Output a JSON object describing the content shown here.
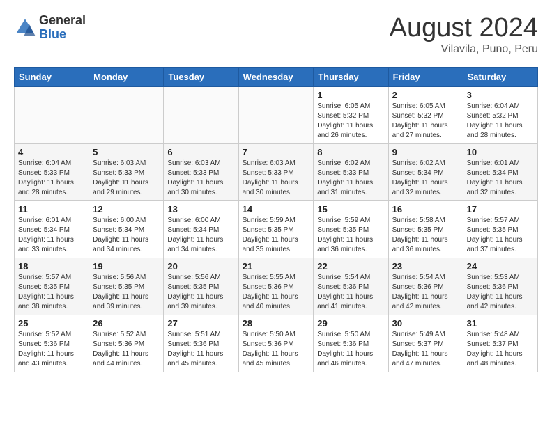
{
  "header": {
    "logo_general": "General",
    "logo_blue": "Blue",
    "title": "August 2024",
    "subtitle": "Vilavila, Puno, Peru"
  },
  "days_of_week": [
    "Sunday",
    "Monday",
    "Tuesday",
    "Wednesday",
    "Thursday",
    "Friday",
    "Saturday"
  ],
  "weeks": [
    [
      {
        "day": "",
        "info": ""
      },
      {
        "day": "",
        "info": ""
      },
      {
        "day": "",
        "info": ""
      },
      {
        "day": "",
        "info": ""
      },
      {
        "day": "1",
        "info": "Sunrise: 6:05 AM\nSunset: 5:32 PM\nDaylight: 11 hours and 26 minutes."
      },
      {
        "day": "2",
        "info": "Sunrise: 6:05 AM\nSunset: 5:32 PM\nDaylight: 11 hours and 27 minutes."
      },
      {
        "day": "3",
        "info": "Sunrise: 6:04 AM\nSunset: 5:32 PM\nDaylight: 11 hours and 28 minutes."
      }
    ],
    [
      {
        "day": "4",
        "info": "Sunrise: 6:04 AM\nSunset: 5:33 PM\nDaylight: 11 hours and 28 minutes."
      },
      {
        "day": "5",
        "info": "Sunrise: 6:03 AM\nSunset: 5:33 PM\nDaylight: 11 hours and 29 minutes."
      },
      {
        "day": "6",
        "info": "Sunrise: 6:03 AM\nSunset: 5:33 PM\nDaylight: 11 hours and 30 minutes."
      },
      {
        "day": "7",
        "info": "Sunrise: 6:03 AM\nSunset: 5:33 PM\nDaylight: 11 hours and 30 minutes."
      },
      {
        "day": "8",
        "info": "Sunrise: 6:02 AM\nSunset: 5:33 PM\nDaylight: 11 hours and 31 minutes."
      },
      {
        "day": "9",
        "info": "Sunrise: 6:02 AM\nSunset: 5:34 PM\nDaylight: 11 hours and 32 minutes."
      },
      {
        "day": "10",
        "info": "Sunrise: 6:01 AM\nSunset: 5:34 PM\nDaylight: 11 hours and 32 minutes."
      }
    ],
    [
      {
        "day": "11",
        "info": "Sunrise: 6:01 AM\nSunset: 5:34 PM\nDaylight: 11 hours and 33 minutes."
      },
      {
        "day": "12",
        "info": "Sunrise: 6:00 AM\nSunset: 5:34 PM\nDaylight: 11 hours and 34 minutes."
      },
      {
        "day": "13",
        "info": "Sunrise: 6:00 AM\nSunset: 5:34 PM\nDaylight: 11 hours and 34 minutes."
      },
      {
        "day": "14",
        "info": "Sunrise: 5:59 AM\nSunset: 5:35 PM\nDaylight: 11 hours and 35 minutes."
      },
      {
        "day": "15",
        "info": "Sunrise: 5:59 AM\nSunset: 5:35 PM\nDaylight: 11 hours and 36 minutes."
      },
      {
        "day": "16",
        "info": "Sunrise: 5:58 AM\nSunset: 5:35 PM\nDaylight: 11 hours and 36 minutes."
      },
      {
        "day": "17",
        "info": "Sunrise: 5:57 AM\nSunset: 5:35 PM\nDaylight: 11 hours and 37 minutes."
      }
    ],
    [
      {
        "day": "18",
        "info": "Sunrise: 5:57 AM\nSunset: 5:35 PM\nDaylight: 11 hours and 38 minutes."
      },
      {
        "day": "19",
        "info": "Sunrise: 5:56 AM\nSunset: 5:35 PM\nDaylight: 11 hours and 39 minutes."
      },
      {
        "day": "20",
        "info": "Sunrise: 5:56 AM\nSunset: 5:35 PM\nDaylight: 11 hours and 39 minutes."
      },
      {
        "day": "21",
        "info": "Sunrise: 5:55 AM\nSunset: 5:36 PM\nDaylight: 11 hours and 40 minutes."
      },
      {
        "day": "22",
        "info": "Sunrise: 5:54 AM\nSunset: 5:36 PM\nDaylight: 11 hours and 41 minutes."
      },
      {
        "day": "23",
        "info": "Sunrise: 5:54 AM\nSunset: 5:36 PM\nDaylight: 11 hours and 42 minutes."
      },
      {
        "day": "24",
        "info": "Sunrise: 5:53 AM\nSunset: 5:36 PM\nDaylight: 11 hours and 42 minutes."
      }
    ],
    [
      {
        "day": "25",
        "info": "Sunrise: 5:52 AM\nSunset: 5:36 PM\nDaylight: 11 hours and 43 minutes."
      },
      {
        "day": "26",
        "info": "Sunrise: 5:52 AM\nSunset: 5:36 PM\nDaylight: 11 hours and 44 minutes."
      },
      {
        "day": "27",
        "info": "Sunrise: 5:51 AM\nSunset: 5:36 PM\nDaylight: 11 hours and 45 minutes."
      },
      {
        "day": "28",
        "info": "Sunrise: 5:50 AM\nSunset: 5:36 PM\nDaylight: 11 hours and 45 minutes."
      },
      {
        "day": "29",
        "info": "Sunrise: 5:50 AM\nSunset: 5:36 PM\nDaylight: 11 hours and 46 minutes."
      },
      {
        "day": "30",
        "info": "Sunrise: 5:49 AM\nSunset: 5:37 PM\nDaylight: 11 hours and 47 minutes."
      },
      {
        "day": "31",
        "info": "Sunrise: 5:48 AM\nSunset: 5:37 PM\nDaylight: 11 hours and 48 minutes."
      }
    ]
  ]
}
